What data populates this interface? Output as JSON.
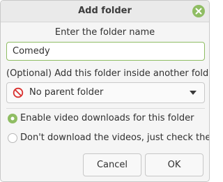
{
  "window": {
    "title": "Add folder",
    "close_icon": "close-icon"
  },
  "form": {
    "prompt": "Enter the folder name",
    "folder_name_value": "Comedy",
    "parent_label": "(Optional) Add this folder inside another folder",
    "parent_select": {
      "selected": "No parent folder",
      "icon": "no-entry-icon"
    },
    "radio_options": [
      {
        "label": "Enable video downloads for this folder",
        "selected": true
      },
      {
        "label": "Don't download the videos, just check them",
        "selected": false
      }
    ]
  },
  "buttons": {
    "cancel": "Cancel",
    "ok": "OK"
  },
  "colors": {
    "accent": "#8fbd63",
    "window_bg": "#f5f5f5",
    "no_entry_red": "#d9302e"
  }
}
